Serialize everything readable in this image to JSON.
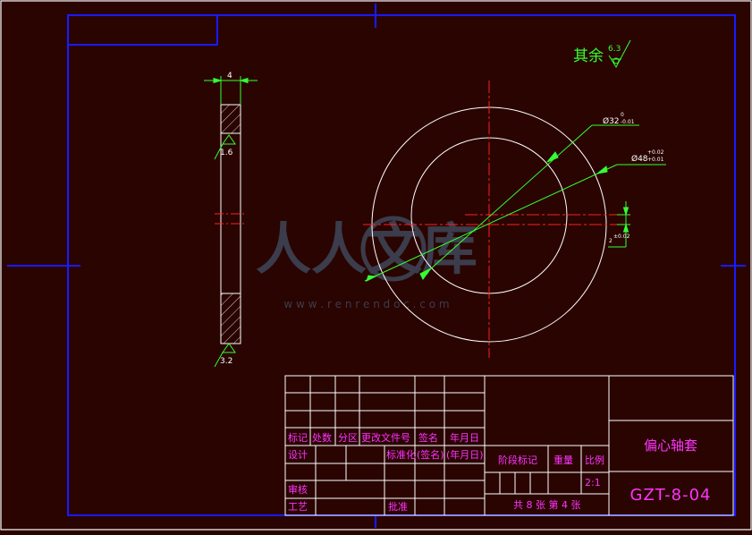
{
  "drawing": {
    "roughness_note": "其余",
    "roughness_main": "6.3",
    "side_view": {
      "thickness": "4",
      "roughness_top": "1.6",
      "roughness_bottom": "3.2"
    },
    "front_view": {
      "bore_dim": "Ø32",
      "bore_tol_upper": "0",
      "bore_tol_lower": "-0.01",
      "outer_dim": "Ø48",
      "outer_tol_upper": "+0.02",
      "outer_tol_lower": "+0.01",
      "eccentric_dim": "2",
      "eccentric_tol": "±0.02"
    },
    "watermark": {
      "text": "人人文库",
      "url": "w w w . r e n r e n d o c . c o m"
    }
  },
  "title_block": {
    "rev_headers": [
      "标记",
      "处数",
      "分区",
      "更改文件号",
      "签名",
      "年月日"
    ],
    "design": "设计",
    "standardize": "标准化",
    "sign": "(签名)",
    "date": "(年月日)",
    "review": "审核",
    "process": "工艺",
    "approve": "批准",
    "stage": "阶段标记",
    "weight": "重量",
    "scale_label": "比例",
    "scale": "2:1",
    "sheets": "共 8 张  第 4 张",
    "part_name": "偏心轴套",
    "drawing_no": "GZT-8-04"
  }
}
